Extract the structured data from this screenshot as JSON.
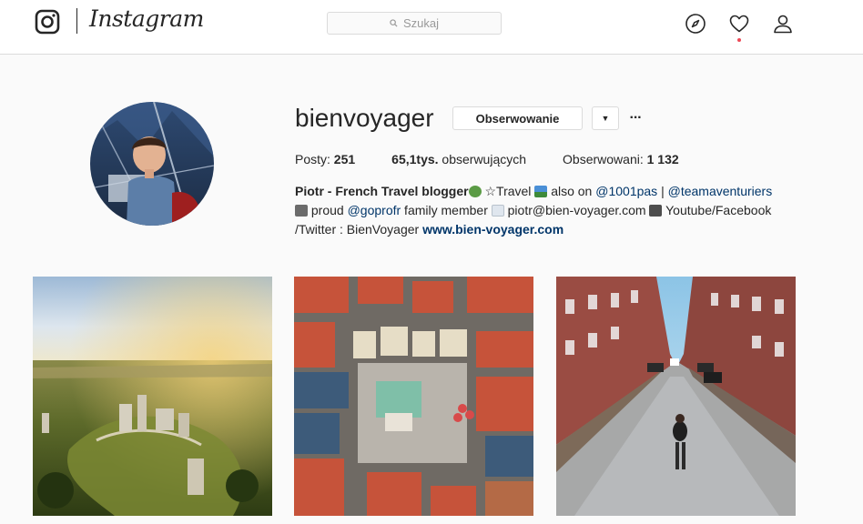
{
  "nav": {
    "wordmark": "Instagram",
    "search_placeholder": "Szukaj",
    "icons": [
      "instagram-glyph-icon",
      "search-icon",
      "explore-compass-icon",
      "heart-icon",
      "profile-icon"
    ]
  },
  "profile": {
    "username": "bienvoyager",
    "follow_label": "Obserwowanie",
    "dropdown_glyph": "▼",
    "more_glyph": "···",
    "stats": {
      "posts_label": "Posty:",
      "posts_value": "251",
      "followers_value": "65,1tys.",
      "followers_label": "obserwujących",
      "following_label": "Obserwowani:",
      "following_value": "1 132"
    },
    "bio": {
      "name": "Piotr - French Travel blogger",
      "text1": " ☆Travel ",
      "text2": " also on ",
      "mention1": "@1001pas",
      "sep": " | ",
      "mention2": "@teamaventuriers",
      "text3": " proud ",
      "mention3": "@goprofr",
      "text4": " family member ",
      "email": " piotr@bien-voyager.com ",
      "text5": " Youtube/Facebook /Twitter : BienVoyager ",
      "website": "www.bien-voyager.com"
    }
  },
  "posts": [
    {
      "subject": "castle-ruins-aerial-sunset"
    },
    {
      "subject": "town-square-aerial"
    },
    {
      "subject": "cobblestone-street-brick-houses"
    }
  ],
  "colors": {
    "text": "#262626",
    "link": "#003569",
    "border": "#dbdbdb",
    "background": "#fafafa",
    "notification": "#ed4956"
  }
}
